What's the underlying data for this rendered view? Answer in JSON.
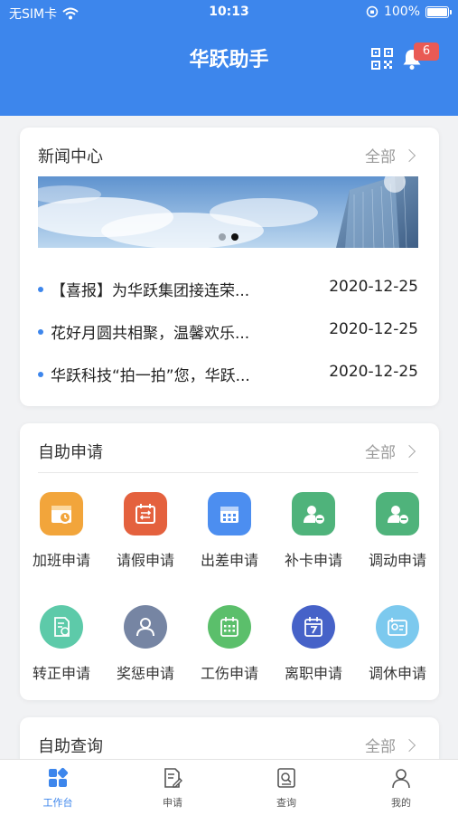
{
  "status": {
    "carrier": "无SIM卡",
    "time": "10:13",
    "battery": "100%"
  },
  "header": {
    "title": "华跃助手",
    "notification_count": "6"
  },
  "news": {
    "title": "新闻中心",
    "more": "全部",
    "carousel_pages": 2,
    "carousel_active": 2,
    "items": [
      {
        "title": "【喜报】为华跃集团接连荣...",
        "date": "2020-12-25"
      },
      {
        "title": "花好月圆共相聚，温馨欢乐...",
        "date": "2020-12-25"
      },
      {
        "title": "华跃科技“拍一拍”您，华跃...",
        "date": "2020-12-25"
      }
    ]
  },
  "apply": {
    "title": "自助申请",
    "more": "全部",
    "items": [
      {
        "label": "加班申请",
        "icon": "overtime-icon",
        "color": "#f2a53b"
      },
      {
        "label": "请假申请",
        "icon": "leave-icon",
        "color": "#e4613e"
      },
      {
        "label": "出差申请",
        "icon": "business-trip-icon",
        "color": "#4c8ef0"
      },
      {
        "label": "补卡申请",
        "icon": "card-repair-icon",
        "color": "#4fb37b"
      },
      {
        "label": "调动申请",
        "icon": "transfer-icon",
        "color": "#4fb37b"
      },
      {
        "label": "转正申请",
        "icon": "regularization-icon",
        "color": "#5dcaa9"
      },
      {
        "label": "奖惩申请",
        "icon": "reward-punish-icon",
        "color": "#7685a3"
      },
      {
        "label": "工伤申请",
        "icon": "injury-icon",
        "color": "#5bbf6b"
      },
      {
        "label": "离职申请",
        "icon": "resign-icon",
        "color": "#4662c8"
      },
      {
        "label": "调休申请",
        "icon": "comp-leave-icon",
        "color": "#7cc9ee"
      }
    ]
  },
  "query": {
    "title": "自助查询",
    "more": "全部"
  },
  "tabs": [
    {
      "label": "工作台",
      "icon": "workbench-icon",
      "active": true
    },
    {
      "label": "申请",
      "icon": "apply-icon",
      "active": false
    },
    {
      "label": "查询",
      "icon": "query-icon",
      "active": false
    },
    {
      "label": "我的",
      "icon": "profile-icon",
      "active": false
    }
  ],
  "colors": {
    "primary": "#3d86ec",
    "badge": "#e95a54"
  }
}
